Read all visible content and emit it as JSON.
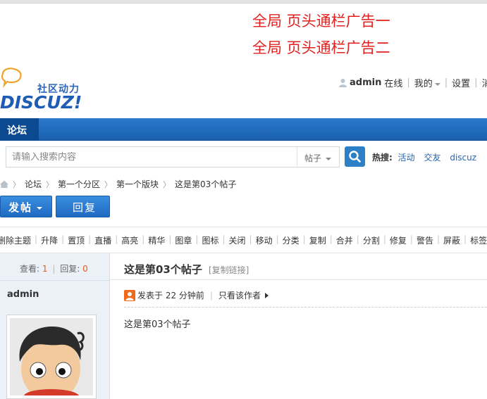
{
  "ads": {
    "line1": "全局 页头通栏广告一",
    "line2": "全局 页头通栏广告二"
  },
  "logo": {
    "subtitle": "社区动力",
    "wordmark": "DISCUZ!"
  },
  "userbar": {
    "username": "admin",
    "status": "在线",
    "my": "我的",
    "settings": "设置",
    "messages": "消息"
  },
  "nav": {
    "forum_tab": "论坛"
  },
  "search": {
    "placeholder": "请输入搜索内容",
    "type": "帖子",
    "hot_label": "热搜:",
    "hot_terms": [
      "活动",
      "交友",
      "discuz"
    ]
  },
  "breadcrumb": {
    "items": [
      "论坛",
      "第一个分区",
      "第一个版块",
      "这是第03个帖子"
    ]
  },
  "actions": {
    "post": "发帖",
    "reply": "回复"
  },
  "mod_toolbar": {
    "items": [
      "删除主题",
      "升降",
      "置顶",
      "直播",
      "高亮",
      "精华",
      "图章",
      "图标",
      "关闭",
      "移动",
      "分类",
      "复制",
      "合并",
      "分割",
      "修复",
      "警告",
      "屏蔽",
      "标签"
    ]
  },
  "thread": {
    "views_label": "查看:",
    "views": "1",
    "replies_label": "回复:",
    "replies": "0",
    "title": "这是第03个帖子",
    "copy_link": "[复制链接]",
    "author": "admin",
    "posted": "发表于 22 分钟前",
    "only_author": "只看该作者",
    "body": "这是第03个帖子"
  },
  "colors": {
    "ad_red": "#e0211f",
    "nav_blue": "#1a5fae",
    "link_blue": "#2a64ad",
    "count_orange": "#e65a1e"
  }
}
